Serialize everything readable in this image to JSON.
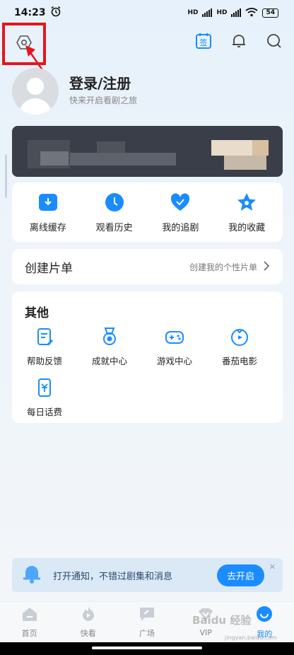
{
  "status_bar": {
    "time": "14:23",
    "net1": "HD",
    "net2": "HD",
    "battery": "54"
  },
  "header": {
    "sign_label": "签"
  },
  "profile": {
    "title": "登录/注册",
    "subtitle": "快来开启看剧之旅"
  },
  "quick_actions": [
    {
      "label": "离线缓存",
      "icon": "download-icon"
    },
    {
      "label": "观看历史",
      "icon": "clock-icon"
    },
    {
      "label": "我的追剧",
      "icon": "heart-icon"
    },
    {
      "label": "我的收藏",
      "icon": "star-icon"
    }
  ],
  "playlist": {
    "title": "创建片单",
    "action": "创建我的个性片单"
  },
  "other": {
    "title": "其他",
    "items": [
      {
        "label": "帮助反馈",
        "icon": "feedback-icon"
      },
      {
        "label": "成就中心",
        "icon": "medal-icon"
      },
      {
        "label": "游戏中心",
        "icon": "gamepad-icon"
      },
      {
        "label": "番茄电影",
        "icon": "tomato-icon"
      },
      {
        "label": "每日话费",
        "icon": "phone-bill-icon"
      }
    ]
  },
  "notify": {
    "text": "打开通知，不错过剧集和消息",
    "button": "去开启",
    "close": "✕"
  },
  "tabs": [
    {
      "label": "首页",
      "icon": "home-icon",
      "active": false
    },
    {
      "label": "快看",
      "icon": "flame-icon",
      "active": false
    },
    {
      "label": "广场",
      "icon": "square-icon",
      "active": false
    },
    {
      "label": "VIP",
      "icon": "vip-icon",
      "active": false
    },
    {
      "label": "我的",
      "icon": "me-icon",
      "active": true
    }
  ],
  "watermark": {
    "brand": "Baidu 经验",
    "url": "jingyan.baidu.com"
  },
  "colors": {
    "accent": "#1a8cff",
    "highlight_box": "#e8141b"
  }
}
